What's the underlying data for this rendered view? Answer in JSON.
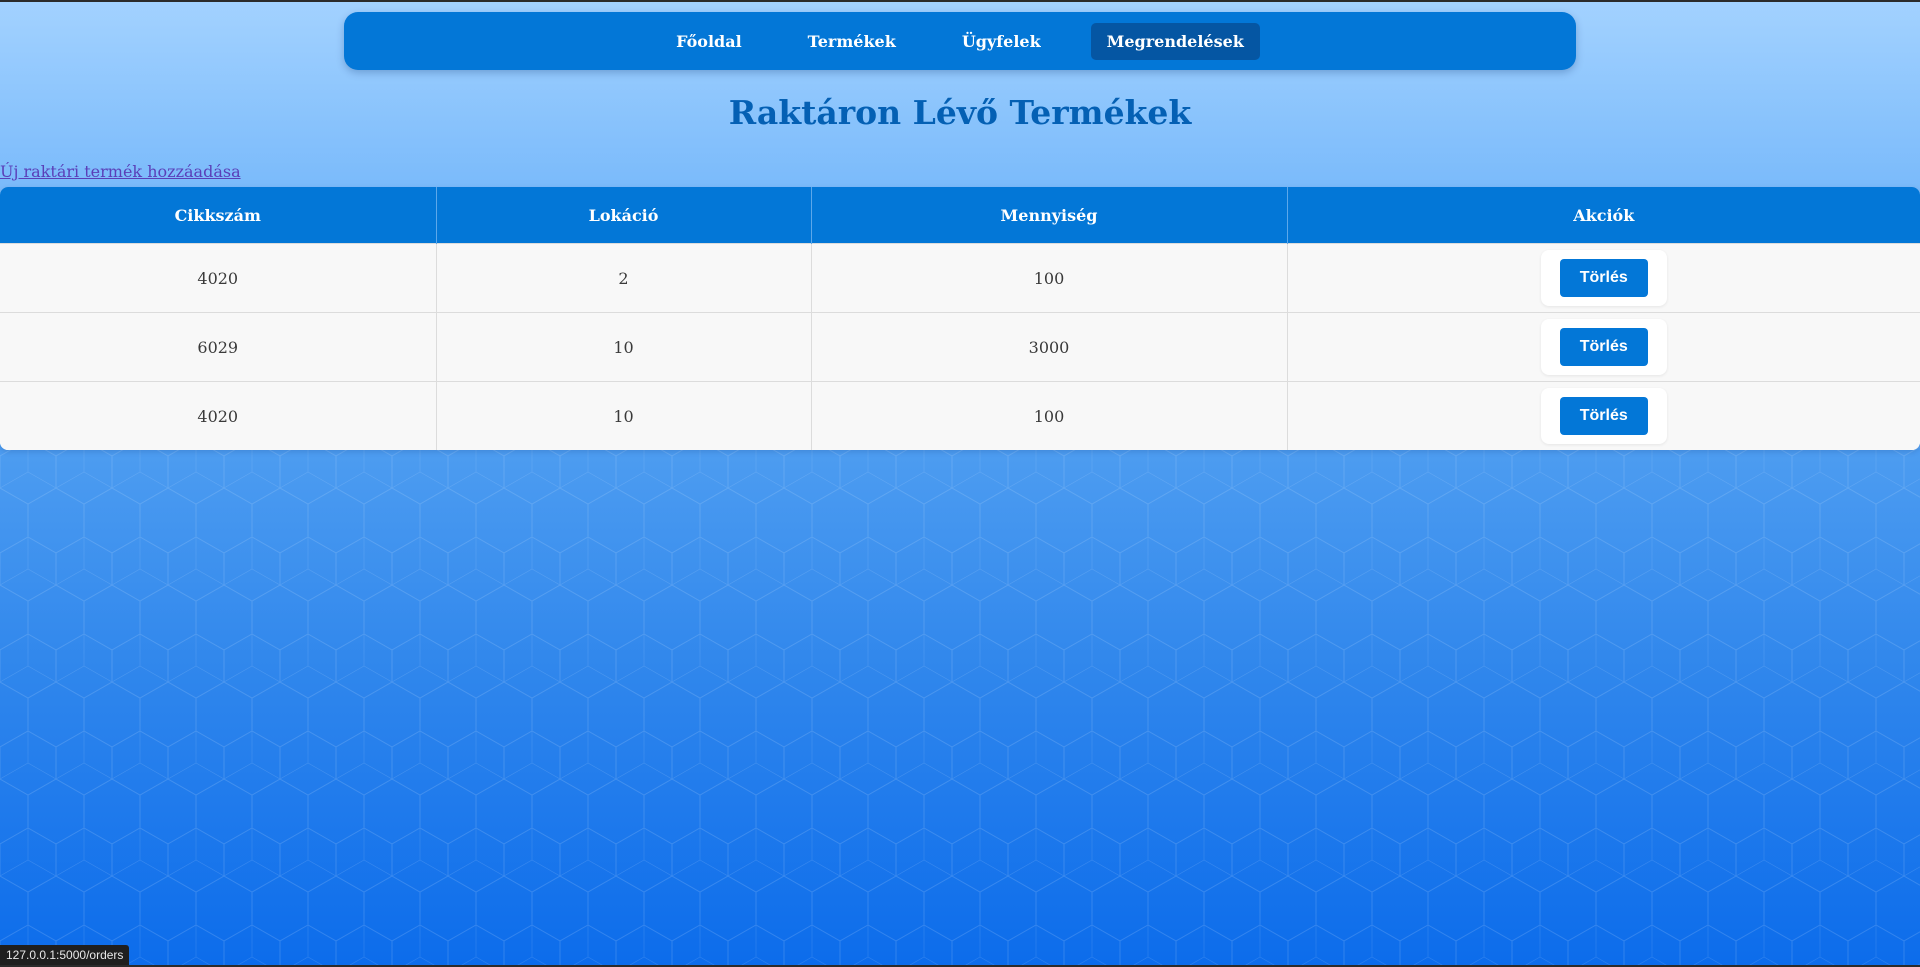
{
  "nav": {
    "items": [
      {
        "label": "Főoldal",
        "active": false
      },
      {
        "label": "Termékek",
        "active": false
      },
      {
        "label": "Ügyfelek",
        "active": false
      },
      {
        "label": "Megrendelések",
        "active": true
      }
    ]
  },
  "page": {
    "title": "Raktáron Lévő Termékek",
    "add_link": "Új raktári termék hozzáadása"
  },
  "table": {
    "headers": [
      "Cikkszám",
      "Lokáció",
      "Mennyiség",
      "Akciók"
    ],
    "rows": [
      {
        "cikkszam": "4020",
        "lokacio": "2",
        "mennyiseg": "100",
        "action": "Törlés"
      },
      {
        "cikkszam": "6029",
        "lokacio": "10",
        "mennyiseg": "3000",
        "action": "Törlés"
      },
      {
        "cikkszam": "4020",
        "lokacio": "10",
        "mennyiseg": "100",
        "action": "Törlés"
      }
    ]
  },
  "status_bar": {
    "url": "127.0.0.1:5000/orders"
  },
  "colors": {
    "primary": "#0377d7",
    "nav_active": "#0556a3",
    "title": "#0460b4",
    "link": "#5a3fb8"
  }
}
